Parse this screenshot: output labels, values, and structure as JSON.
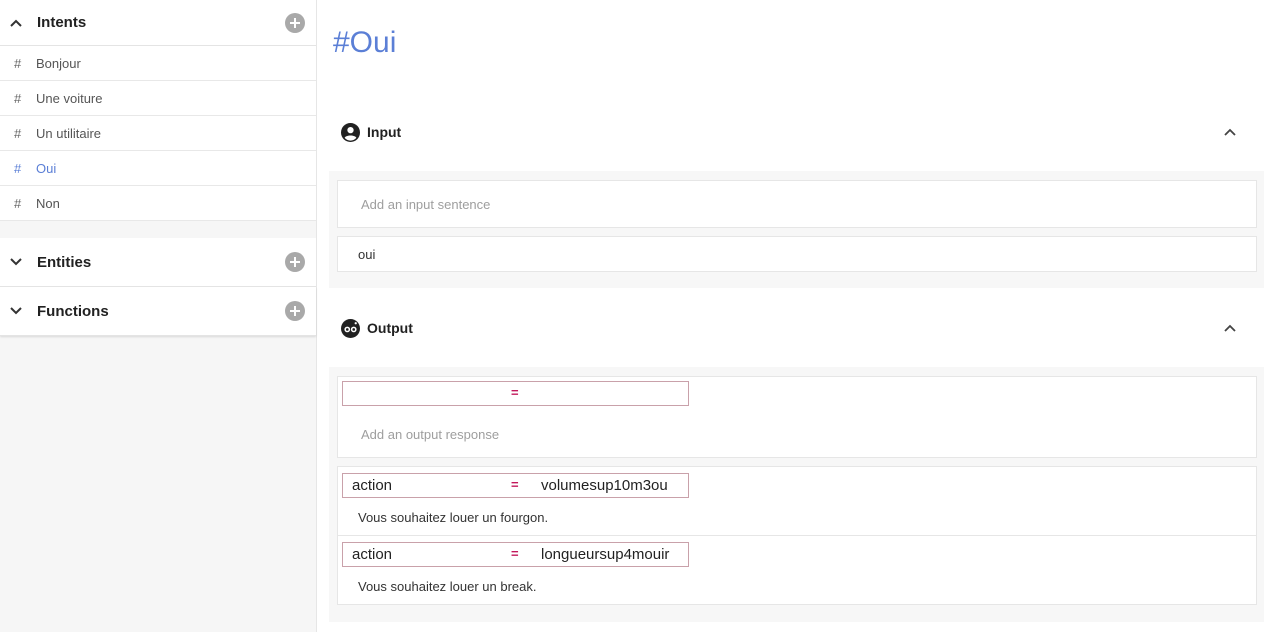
{
  "sidebar": {
    "intents": {
      "title": "Intents",
      "items": [
        {
          "hash": "#",
          "label": "Bonjour"
        },
        {
          "hash": "#",
          "label": "Une voiture"
        },
        {
          "hash": "#",
          "label": "Un utilitaire"
        },
        {
          "hash": "#",
          "label": "Oui"
        },
        {
          "hash": "#",
          "label": "Non"
        }
      ],
      "active_index": 3
    },
    "entities": {
      "title": "Entities"
    },
    "functions": {
      "title": "Functions"
    }
  },
  "main": {
    "title": "#Oui",
    "input": {
      "title": "Input",
      "placeholder": "Add an input sentence",
      "sentences": [
        "oui"
      ]
    },
    "output": {
      "title": "Output",
      "new_condition": {
        "key": "",
        "eq": "=",
        "value": ""
      },
      "placeholder": "Add an output response",
      "responses": [
        {
          "key": "action",
          "eq": "=",
          "value": "volumesup10m3ou",
          "text": "Vous souhaitez louer un fourgon."
        },
        {
          "key": "action",
          "eq": "=",
          "value": "longueursup4mouir",
          "text": "Vous souhaitez louer un break."
        }
      ]
    }
  },
  "colors": {
    "accent": "#5b7fd6",
    "operator": "#c2185b",
    "add_button": "#a9a9a9"
  },
  "icons": {
    "collapse": "chevron-up-icon",
    "expand": "chevron-down-icon",
    "add": "plus-circle-icon",
    "input": "account-circle-icon",
    "output": "bot-eyes-icon"
  }
}
